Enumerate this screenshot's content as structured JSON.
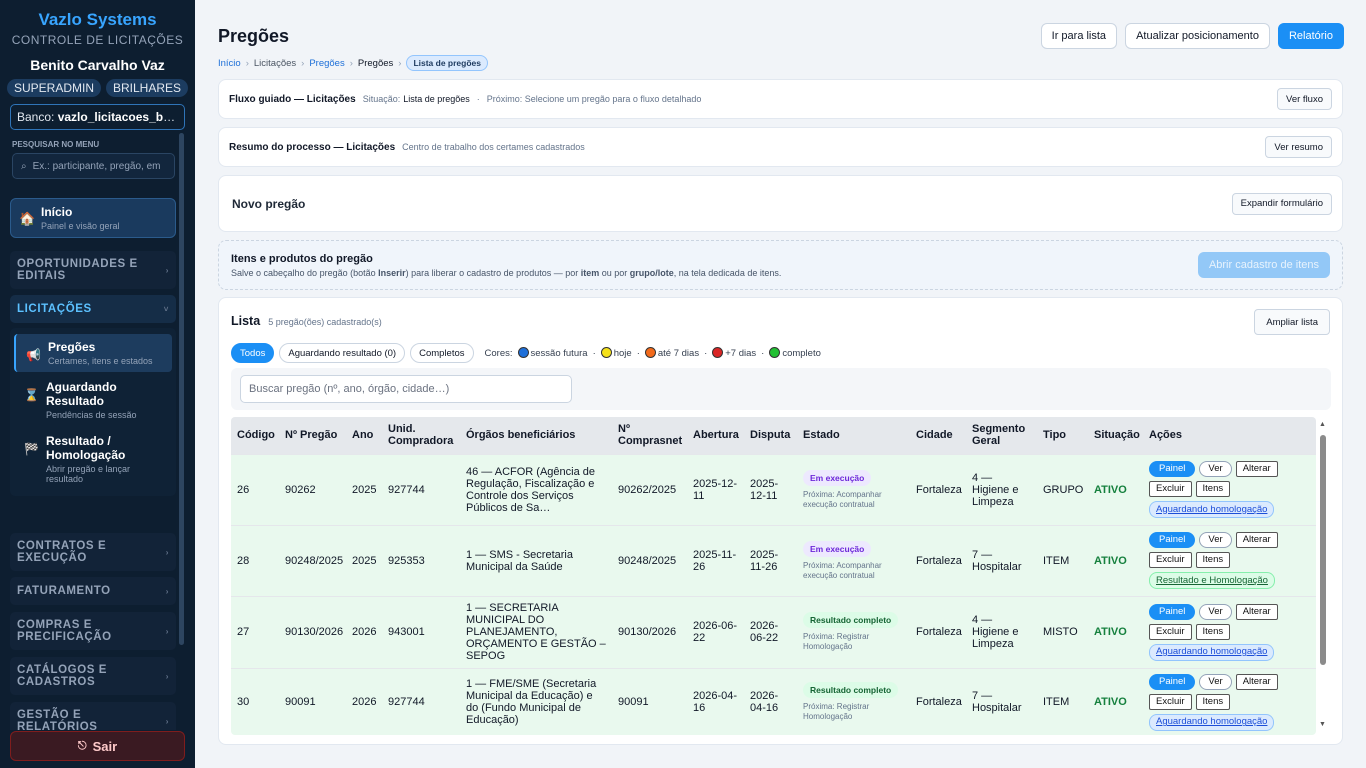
{
  "sidebar": {
    "brand": "Vazlo Systems",
    "subtitle": "CONTROLE DE LICITAÇÕES",
    "user": "Benito Carvalho Vaz",
    "badges": [
      "SUPERADMIN",
      "BRILHARES"
    ],
    "db_label": "Banco:",
    "db_value": "vazlo_licitacoes_brilhares",
    "search_label": "PESQUISAR NO MENU",
    "search_placeholder": "Ex.: participante, pregão, em",
    "home": {
      "title": "Início",
      "desc": "Painel e visão geral"
    },
    "sections": {
      "oportunidades": "OPORTUNIDADES E EDITAIS",
      "licitacoes": "LICITAÇÕES",
      "contratos": "CONTRATOS E EXECUÇÃO",
      "faturamento": "FATURAMENTO",
      "compras": "COMPRAS E PRECIFICAÇÃO",
      "catalogos": "CATÁLOGOS E CADASTROS",
      "gestao": "GESTÃO E RELATÓRIOS"
    },
    "sub": [
      {
        "title": "Pregões",
        "desc": "Certames, itens e estados",
        "icon": "📢"
      },
      {
        "title": "Aguardando Resultado",
        "desc": "Pendências de sessão",
        "icon": "⌛"
      },
      {
        "title": "Resultado / Homologação",
        "desc": "Abrir pregão e lançar resultado",
        "icon": "🏁"
      }
    ],
    "logout": "Sair"
  },
  "header": {
    "title": "Pregões",
    "buttons": {
      "ir": "Ir para lista",
      "atualizar": "Atualizar posicionamento",
      "relatorio": "Relatório"
    },
    "crumbs": {
      "inicio": "Início",
      "licitacoes": "Licitações",
      "pregoes1": "Pregões",
      "pregoes2": "Pregões",
      "lista": "Lista de pregões"
    }
  },
  "fluxo": {
    "title": "Fluxo guiado — Licitações",
    "situacao_label": "Situação:",
    "situacao": "Lista de pregões",
    "proximo": "Próximo: Selecione um pregão para o fluxo detalhado",
    "button": "Ver fluxo"
  },
  "resumo": {
    "title": "Resumo do processo — Licitações",
    "desc": "Centro de trabalho dos certames cadastrados",
    "button": "Ver resumo"
  },
  "novo": {
    "title": "Novo pregão",
    "button": "Expandir formulário"
  },
  "itens": {
    "title": "Itens e produtos do pregão",
    "desc_a": "Salve o cabeçalho do pregão (botão ",
    "desc_b": "Inserir",
    "desc_c": ") para liberar o cadastro de produtos — por ",
    "desc_d": "item",
    "desc_e": " ou por ",
    "desc_f": "grupo/lote",
    "desc_g": ", na tela dedicada de itens.",
    "button": "Abrir cadastro de itens"
  },
  "lista": {
    "title": "Lista",
    "count": "5 pregão(ões) cadastrado(s)",
    "button": "Ampliar lista",
    "tabs": [
      "Todos",
      "Aguardando resultado (0)",
      "Completos"
    ],
    "legend_label": "Cores:",
    "legend": [
      {
        "label": "sessão futura",
        "color": "#1e6fd9"
      },
      {
        "label": "hoje",
        "color": "#f5e11a"
      },
      {
        "label": "até 7 dias",
        "color": "#f26a1b"
      },
      {
        "label": "+7 dias",
        "color": "#d92525"
      },
      {
        "label": "completo",
        "color": "#22c033"
      }
    ],
    "search_placeholder": "Buscar pregão (nº, ano, órgão, cidade…)",
    "columns": [
      "Código",
      "Nº Pregão",
      "Ano",
      "Unid. Compradora",
      "Órgãos beneficiários",
      "Nº Comprasnet",
      "Abertura",
      "Disputa",
      "Estado",
      "Cidade",
      "Segmento Geral",
      "Tipo",
      "Situação",
      "Ações"
    ],
    "rows": [
      {
        "codigo": "26",
        "pregao": "90262",
        "ano": "2025",
        "unid": "927744",
        "orgaos": "46 — ACFOR (Agência de Regulação, Fiscalização e Controle dos Serviços Públicos de Sa…",
        "comprasnet": "90262/2025",
        "abertura": "2025-12-11",
        "disputa": "2025-12-11",
        "estado": "Em execução",
        "proxima": "Próxima: Acompanhar execução contratual",
        "cidade": "Fortaleza",
        "segmento": "4 — Higiene e Limpeza",
        "tipo": "GRUPO",
        "situacao": "ATIVO",
        "link": "Aguardando homologação"
      },
      {
        "codigo": "28",
        "pregao": "90248/2025",
        "ano": "2025",
        "unid": "925353",
        "orgaos": "1 — SMS - Secretaria Municipal da Saúde",
        "comprasnet": "90248/2025",
        "abertura": "2025-11-26",
        "disputa": "2025-11-26",
        "estado": "Em execução",
        "proxima": "Próxima: Acompanhar execução contratual",
        "cidade": "Fortaleza",
        "segmento": "7 — Hospitalar",
        "tipo": "ITEM",
        "situacao": "ATIVO",
        "link": "Resultado e Homologação"
      },
      {
        "codigo": "27",
        "pregao": "90130/2026",
        "ano": "2026",
        "unid": "943001",
        "orgaos": "1 — SECRETARIA MUNICIPAL DO PLANEJAMENTO, ORÇAMENTO E GESTÃO – SEPOG",
        "comprasnet": "90130/2026",
        "abertura": "2026-06-22",
        "disputa": "2026-06-22",
        "estado": "Resultado completo",
        "proxima": "Próxima: Registrar Homologação",
        "cidade": "Fortaleza",
        "segmento": "4 — Higiene e Limpeza",
        "tipo": "MISTO",
        "situacao": "ATIVO",
        "link": "Aguardando homologação"
      },
      {
        "codigo": "30",
        "pregao": "90091",
        "ano": "2026",
        "unid": "927744",
        "orgaos": "1 — FME/SME (Secretaria Municipal da Educação) e do (Fundo Municipal de Educação)",
        "comprasnet": "90091",
        "abertura": "2026-04-16",
        "disputa": "2026-04-16",
        "estado": "Resultado completo",
        "proxima": "Próxima: Registrar Homologação",
        "cidade": "Fortaleza",
        "segmento": "7 — Hospitalar",
        "tipo": "ITEM",
        "situacao": "ATIVO",
        "link": "Aguardando homologação"
      }
    ],
    "actions": {
      "painel": "Painel",
      "ver": "Ver",
      "alterar": "Alterar",
      "excluir": "Excluir",
      "itens": "Itens"
    }
  }
}
